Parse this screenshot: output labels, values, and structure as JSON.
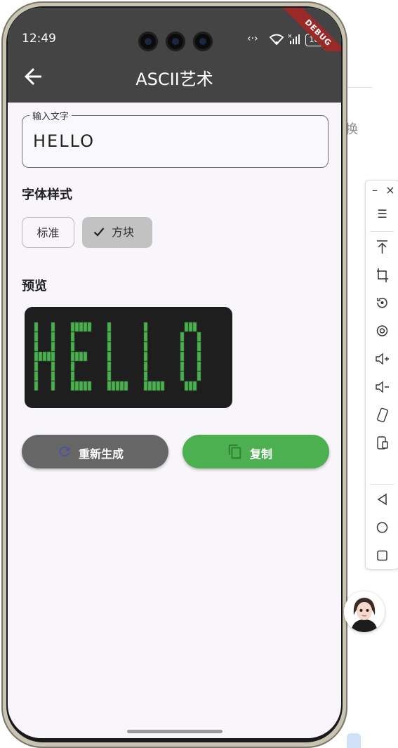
{
  "background": {
    "fragment_text": "换"
  },
  "status_bar": {
    "time": "12:49",
    "battery": "100",
    "debug_banner": "DEBUG"
  },
  "app_bar": {
    "title": "ASCII艺术",
    "back_icon": "arrow-back-icon"
  },
  "input": {
    "label": "输入文字",
    "value": "HELLO"
  },
  "font_style": {
    "heading": "字体样式",
    "chips": [
      {
        "label": "标准",
        "selected": false
      },
      {
        "label": "方块",
        "selected": true
      }
    ]
  },
  "preview": {
    "heading": "预览",
    "text_color": "#4caf50",
    "background_color": "#1e1e1e",
    "art_text": "HELLO"
  },
  "actions": {
    "regenerate": {
      "label": "重新生成",
      "icon": "refresh-icon",
      "color": "#666666"
    },
    "copy": {
      "label": "复制",
      "icon": "copy-icon",
      "color": "#4caf50"
    }
  },
  "side_toolbar": {
    "items": [
      "minimize-icon",
      "close-icon",
      "menu-icon",
      "upload-icon",
      "crop-icon",
      "rotate-icon",
      "screen-record-icon",
      "volume-up-icon",
      "volume-down-icon",
      "shake-icon",
      "screenshot-icon",
      "back-icon",
      "home-icon",
      "recents-icon"
    ]
  }
}
